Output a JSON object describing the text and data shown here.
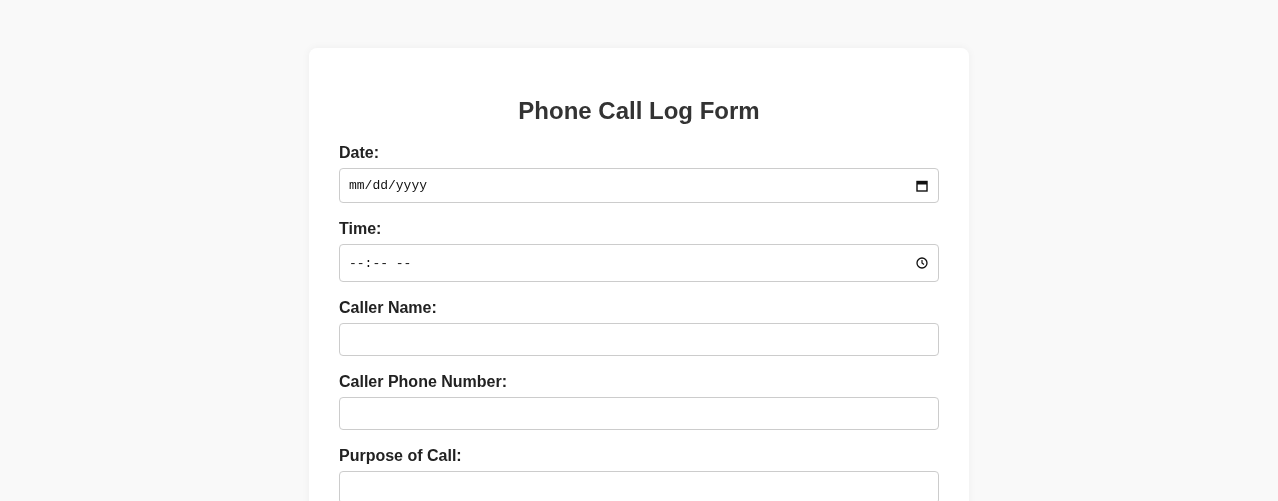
{
  "form": {
    "title": "Phone Call Log Form",
    "fields": [
      {
        "label": "Date:",
        "kind": "date",
        "placeholder": "mm/dd/yyyy"
      },
      {
        "label": "Time:",
        "kind": "time",
        "placeholder": "--:-- --"
      },
      {
        "label": "Caller Name:",
        "kind": "text"
      },
      {
        "label": "Caller Phone Number:",
        "kind": "text"
      },
      {
        "label": "Purpose of Call:",
        "kind": "text"
      }
    ]
  }
}
